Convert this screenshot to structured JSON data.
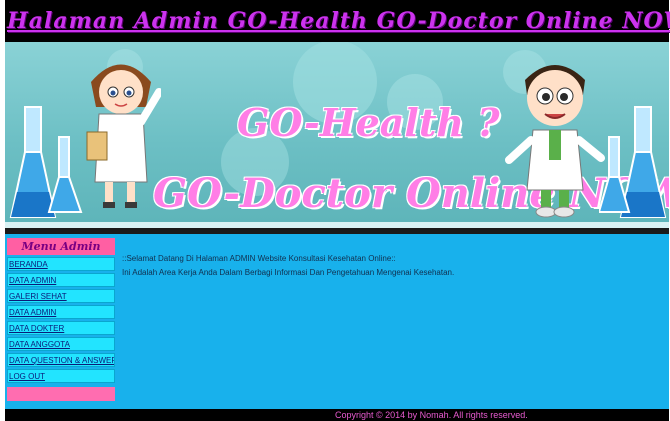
{
  "header": {
    "title": "Halaman Admin GO-Health GO-Doctor Online NOW!"
  },
  "banner": {
    "line1": "GO-Health ?",
    "line2": "GO-Doctor Online NOW!"
  },
  "menu": {
    "title": "Menu Admin",
    "items": [
      {
        "label": "BERANDA"
      },
      {
        "label": "DATA ADMIN"
      },
      {
        "label": "GALERI SEHAT"
      },
      {
        "label": "DATA ADMIN"
      },
      {
        "label": "DATA DOKTER"
      },
      {
        "label": "DATA ANGGOTA"
      },
      {
        "label": "DATA QUESTION & ANSWER"
      },
      {
        "label": "LOG OUT"
      }
    ]
  },
  "main": {
    "welcome_line1": "::Selamat Datang Di Halaman ADMIN Website Konsultasi Kesehatan Online::",
    "welcome_line2": "Ini Adalah Area Kerja Anda Dalam Berbagi Informasi Dan Pengetahuan Mengenai Kesehatan."
  },
  "footer": {
    "copyright": "Copyright © 2014 by Nomah. All rights reserved."
  },
  "colors": {
    "title": "#cc33ee",
    "content_bg": "#18b1ec",
    "menu_header": "#ff5fa3",
    "menu_item": "#22e4ff"
  }
}
